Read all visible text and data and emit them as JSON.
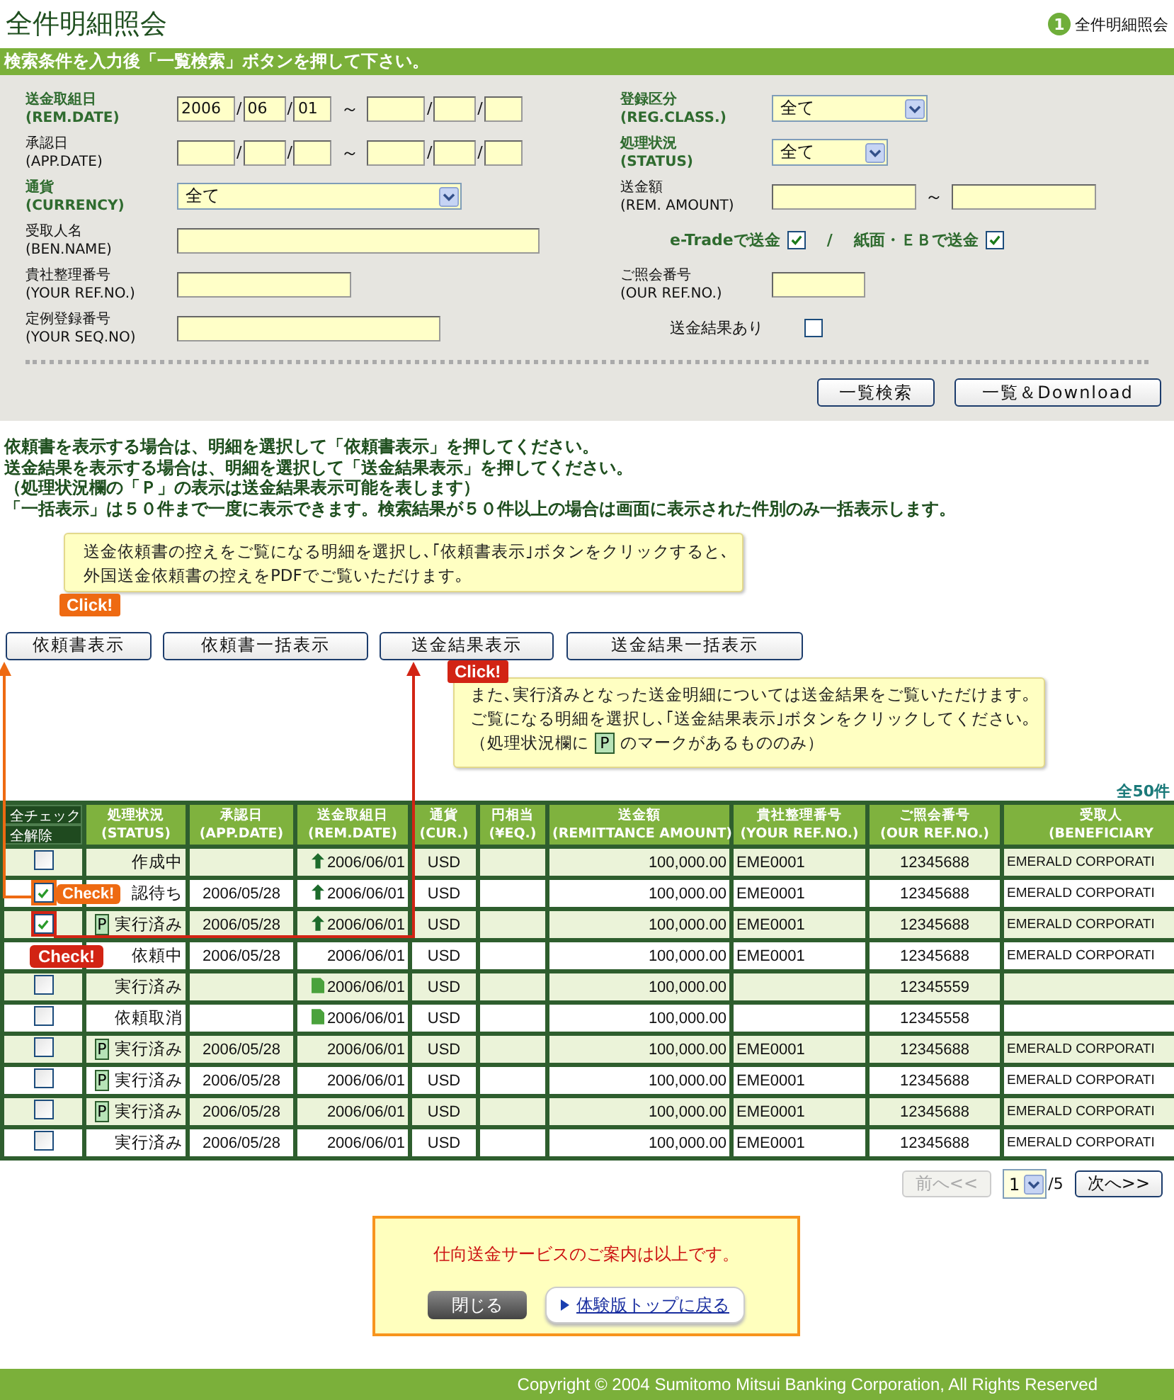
{
  "header": {
    "title": "全件明細照会",
    "step": {
      "number": "1",
      "label": "全件明細照会"
    }
  },
  "instruction_bar": "検索条件を入力後「一覧検索」ボタンを押して下さい。",
  "search_form": {
    "rows": [
      {
        "left": {
          "kind": "date_range",
          "label": "送金取組日",
          "sublabel": "(REM.DATE)",
          "emphasis": true,
          "from": {
            "year": "2006",
            "month": "06",
            "day": "01"
          },
          "slash": "/",
          "tilde": "～"
        },
        "right": {
          "kind": "select",
          "label": "登録区分",
          "sublabel": "(REG.CLASS.)",
          "emphasis": true,
          "value": "全て"
        }
      },
      {
        "left": {
          "kind": "date_range",
          "label": "承認日",
          "sublabel": "(APP.DATE)",
          "emphasis": false,
          "slash": "/",
          "tilde": "～"
        },
        "right": {
          "kind": "select",
          "label": "処理状況",
          "sublabel": "(STATUS)",
          "emphasis": true,
          "value": "全て"
        }
      },
      {
        "left": {
          "kind": "select",
          "label": "通貨",
          "sublabel": "(CURRENCY)",
          "emphasis": true,
          "value": "全て"
        },
        "right": {
          "kind": "amount_range",
          "label": "送金額",
          "sublabel": "(REM. AMOUNT)",
          "emphasis": false,
          "tilde": "～"
        }
      },
      {
        "left": {
          "kind": "text",
          "label": "受取人名",
          "sublabel": "(BEN.NAME)",
          "emphasis": false
        },
        "right": {
          "kind": "checks",
          "separator": "/",
          "items": [
            {
              "label": "e-Tradeで送金",
              "checked": true
            },
            {
              "label": "紙面・ＥＢで送金",
              "checked": true
            }
          ]
        }
      },
      {
        "left": {
          "kind": "text",
          "label": "貴社整理番号",
          "sublabel": "(YOUR REF.NO.)",
          "emphasis": false
        },
        "right": {
          "kind": "text",
          "label": "ご照会番号",
          "sublabel": "(OUR REF.NO.)",
          "emphasis": false
        }
      },
      {
        "left": {
          "kind": "text",
          "label": "定例登録番号",
          "sublabel": "(YOUR SEQ.NO)",
          "emphasis": false
        },
        "right": {
          "kind": "checkbox",
          "label": "送金結果あり",
          "checked": false
        }
      }
    ],
    "buttons": [
      "一覧検索",
      "一覧＆Download"
    ]
  },
  "instructions": [
    "依頼書を表示する場合は、明細を選択して「依頼書表示」を押してください。",
    "送金結果を表示する場合は、明細を選択して「送金結果表示」を押してください。",
    "（処理状況欄の「Ｐ」の表示は送金結果表示可能を表します）",
    "「一括表示」は５０件まで一度に表示できます。検索結果が５０件以上の場合は画面に表示された件別のみ一括表示します。"
  ],
  "notes": [
    {
      "lines": [
        [
          {
            "kind": "text",
            "text": "送金依頼書の控えをご覧になる明細を選択し､｢依頼書表示｣ボタンをクリックすると､"
          }
        ],
        [
          {
            "kind": "text",
            "text": "外国送金依頼書の控えをPDFでご覧いただけます｡"
          }
        ]
      ]
    },
    {
      "lines": [
        [
          {
            "kind": "text",
            "text": "また､実行済みとなった送金明細については送金結果をご覧いただけます｡"
          }
        ],
        [
          {
            "kind": "text",
            "text": "ご覧になる明細を選択し､｢送金結果表示｣ボタンをクリックしてください｡"
          }
        ],
        [
          {
            "kind": "text",
            "text": "（処理状況欄に"
          },
          {
            "kind": "mark",
            "text": "P"
          },
          {
            "kind": "text",
            "text": "のマークがあるもののみ）"
          }
        ]
      ]
    }
  ],
  "action_buttons": [
    {
      "label": "依頼書表示",
      "callout": {
        "text": "Click!",
        "color": "#ee6a12"
      }
    },
    {
      "label": "依頼書一括表示"
    },
    {
      "label": "送金結果表示",
      "callout": {
        "text": "Click!",
        "color": "#d22414"
      }
    },
    {
      "label": "送金結果一括表示"
    }
  ],
  "result_count": "全50件",
  "table": {
    "select_all": [
      "全チェック",
      "全解除"
    ],
    "columns": [
      {
        "title": "処理状況",
        "subtitle": "(STATUS)"
      },
      {
        "title": "承認日",
        "subtitle": "(APP.DATE)"
      },
      {
        "title": "送金取組日",
        "subtitle": "(REM.DATE)"
      },
      {
        "title": "通貨",
        "subtitle": "(CUR.)"
      },
      {
        "title": "円相当",
        "subtitle": "(¥EQ.)"
      },
      {
        "title": "送金額",
        "subtitle": "(REMITTANCE AMOUNT)"
      },
      {
        "title": "貴社整理番号",
        "subtitle": "(YOUR REF.NO.)"
      },
      {
        "title": "ご照会番号",
        "subtitle": "(OUR REF.NO.)"
      },
      {
        "title": "受取人",
        "subtitle": "(BENEFICIARY"
      }
    ],
    "rows": [
      {
        "kind": "arrow",
        "checked": false,
        "status": "作成中",
        "rem_date": "2006/06/01",
        "currency": "USD",
        "amount": "100,000.00",
        "your_ref": "EME0001",
        "our_ref": "12345688",
        "beneficiary": "EMERALD CORPORATI"
      },
      {
        "kind": "arrow",
        "checked": true,
        "callout": {
          "text": "Check!",
          "color": "#ee6a12",
          "kind": "right"
        },
        "status": "認待ち",
        "app_date": "2006/05/28",
        "rem_date": "2006/06/01",
        "currency": "USD",
        "amount": "100,000.00",
        "your_ref": "EME0001",
        "our_ref": "12345688",
        "beneficiary": "EMERALD CORPORATI"
      },
      {
        "kind": "arrow",
        "checked": true,
        "callout": {
          "text": "Check!",
          "color": "#d22414",
          "kind": "below"
        },
        "mark": "P",
        "status": "実行済み",
        "app_date": "2006/05/28",
        "rem_date": "2006/06/01",
        "currency": "USD",
        "amount": "100,000.00",
        "your_ref": "EME0001",
        "our_ref": "12345688",
        "beneficiary": "EMERALD CORPORATI"
      },
      {
        "kind": "plain",
        "status": "依頼中",
        "app_date": "2006/05/28",
        "rem_date": "2006/06/01",
        "currency": "USD",
        "amount": "100,000.00",
        "your_ref": "EME0001",
        "our_ref": "12345688",
        "beneficiary": "EMERALD CORPORATI"
      },
      {
        "kind": "document",
        "checked": false,
        "status": "実行済み",
        "rem_date": "2006/06/01",
        "currency": "USD",
        "amount": "100,000.00",
        "our_ref": "12345559"
      },
      {
        "kind": "document",
        "checked": false,
        "status": "依頼取消",
        "rem_date": "2006/06/01",
        "currency": "USD",
        "amount": "100,000.00",
        "our_ref": "12345558"
      },
      {
        "kind": "plain",
        "checked": false,
        "mark": "P",
        "status": "実行済み",
        "app_date": "2006/05/28",
        "rem_date": "2006/06/01",
        "currency": "USD",
        "amount": "100,000.00",
        "your_ref": "EME0001",
        "our_ref": "12345688",
        "beneficiary": "EMERALD CORPORATI"
      },
      {
        "kind": "plain",
        "checked": false,
        "mark": "P",
        "status": "実行済み",
        "app_date": "2006/05/28",
        "rem_date": "2006/06/01",
        "currency": "USD",
        "amount": "100,000.00",
        "your_ref": "EME0001",
        "our_ref": "12345688",
        "beneficiary": "EMERALD CORPORATI"
      },
      {
        "kind": "plain",
        "checked": false,
        "mark": "P",
        "status": "実行済み",
        "app_date": "2006/05/28",
        "rem_date": "2006/06/01",
        "currency": "USD",
        "amount": "100,000.00",
        "your_ref": "EME0001",
        "our_ref": "12345688",
        "beneficiary": "EMERALD CORPORATI"
      },
      {
        "kind": "plain",
        "checked": false,
        "status": "実行済み",
        "app_date": "2006/05/28",
        "rem_date": "2006/06/01",
        "currency": "USD",
        "amount": "100,000.00",
        "your_ref": "EME0001",
        "our_ref": "12345688",
        "beneficiary": "EMERALD CORPORATI"
      }
    ]
  },
  "pager": {
    "prev": {
      "label": "前へ<<",
      "disabled": true
    },
    "page": "1",
    "total": "/5",
    "next": {
      "label": "次へ>>",
      "disabled": false
    }
  },
  "closing": {
    "message": "仕向送金サービスのご案内は以上です。",
    "close_button": "閉じる",
    "link": "体験版トップに戻る"
  },
  "footer": "Copyright © 2004 Sumitomo Mitsui Banking Corporation, All Rights Reserved"
}
